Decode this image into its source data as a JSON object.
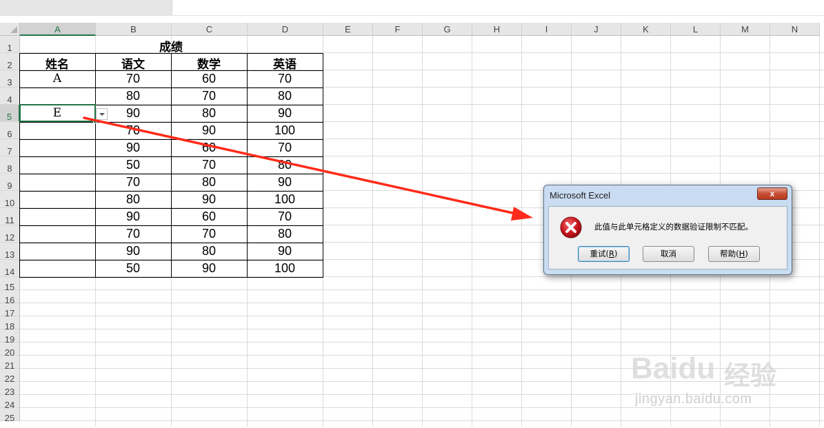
{
  "sheet": {
    "columns": [
      "A",
      "B",
      "C",
      "D",
      "E",
      "F",
      "G",
      "H",
      "I",
      "J",
      "K",
      "L",
      "M",
      "N"
    ],
    "rows": [
      "1",
      "2",
      "3",
      "4",
      "5",
      "6",
      "7",
      "8",
      "9",
      "10",
      "11",
      "12",
      "13",
      "14",
      "15",
      "16",
      "17",
      "18",
      "19",
      "20",
      "21",
      "22",
      "23",
      "24",
      "25"
    ],
    "active_column": "A",
    "active_row": "5"
  },
  "table": {
    "title": "成绩",
    "headers": [
      "姓名",
      "语文",
      "数学",
      "英语"
    ],
    "rows": [
      [
        "A",
        "70",
        "60",
        "70"
      ],
      [
        "",
        "80",
        "70",
        "80"
      ],
      [
        "E",
        "90",
        "80",
        "90"
      ],
      [
        "",
        "70",
        "90",
        "100"
      ],
      [
        "",
        "90",
        "60",
        "70"
      ],
      [
        "",
        "50",
        "70",
        "80"
      ],
      [
        "",
        "70",
        "80",
        "90"
      ],
      [
        "",
        "80",
        "90",
        "100"
      ],
      [
        "",
        "90",
        "60",
        "70"
      ],
      [
        "",
        "70",
        "70",
        "80"
      ],
      [
        "",
        "90",
        "80",
        "90"
      ],
      [
        "",
        "50",
        "90",
        "100"
      ]
    ]
  },
  "dialog": {
    "title": "Microsoft Excel",
    "close_label": "x",
    "message": "此值与此单元格定义的数据验证限制不匹配。",
    "icon": "error-icon",
    "buttons": [
      {
        "label": "重试",
        "key": "R"
      },
      {
        "label": "取消",
        "key": ""
      },
      {
        "label": "帮助",
        "key": "H"
      }
    ]
  },
  "annotation": {
    "arrow_color": "#ff2a1a"
  },
  "watermark": {
    "brand": "Bai",
    "brand2": "du",
    "brand_cn": "经验",
    "url": "jingyan.baidu.com"
  },
  "colors": {
    "excel_green": "#217346",
    "dialog_frame": "#c9dcf1",
    "error_red": "#c8161d"
  }
}
